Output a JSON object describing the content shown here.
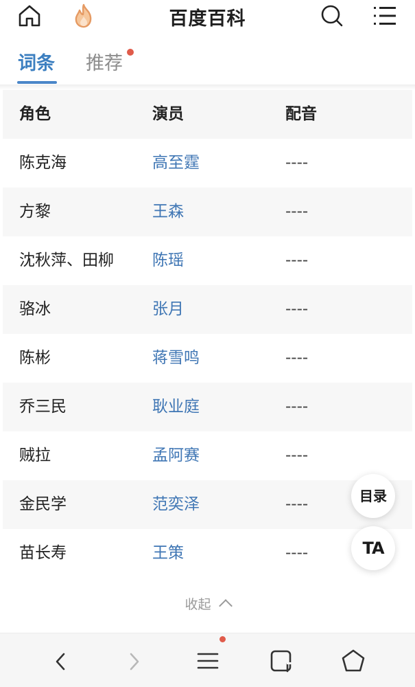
{
  "header": {
    "title": "百度百科",
    "icons": [
      "home-icon",
      "fire-icon",
      "search-icon",
      "menu-icon"
    ]
  },
  "tabs": [
    {
      "label": "词条",
      "active": true
    },
    {
      "label": "推荐",
      "active": false,
      "has_notification_dot": true
    }
  ],
  "table": {
    "headers": [
      "角色",
      "演员",
      "配音"
    ],
    "rows": [
      {
        "role": "陈克海",
        "actor": "高至霆",
        "voice": "----"
      },
      {
        "role": "方黎",
        "actor": "王森",
        "voice": "----"
      },
      {
        "role": "沈秋萍、田柳",
        "actor": "陈瑶",
        "voice": "----"
      },
      {
        "role": "骆冰",
        "actor": "张月",
        "voice": "----"
      },
      {
        "role": "陈彬",
        "actor": "蒋雪鸣",
        "voice": "----"
      },
      {
        "role": "乔三民",
        "actor": "耿业庭",
        "voice": "----"
      },
      {
        "role": "贼拉",
        "actor": "孟阿赛",
        "voice": "----"
      },
      {
        "role": "金民学",
        "actor": "范奕泽",
        "voice": "----"
      },
      {
        "role": "苗长寿",
        "actor": "王策",
        "voice": "----"
      }
    ],
    "collapse_label": "收起"
  },
  "floating": {
    "toc_label": "目录",
    "ta_label": "TA"
  },
  "bottombar": {
    "icons": [
      "back-icon",
      "forward-icon",
      "menu-lines-icon",
      "tabs-icon",
      "home-hexagon-icon"
    ]
  },
  "colors": {
    "accent": "#3c7fc0",
    "link": "#3f76b4",
    "notification": "#e05b4a",
    "fire": "#f2a46a"
  }
}
